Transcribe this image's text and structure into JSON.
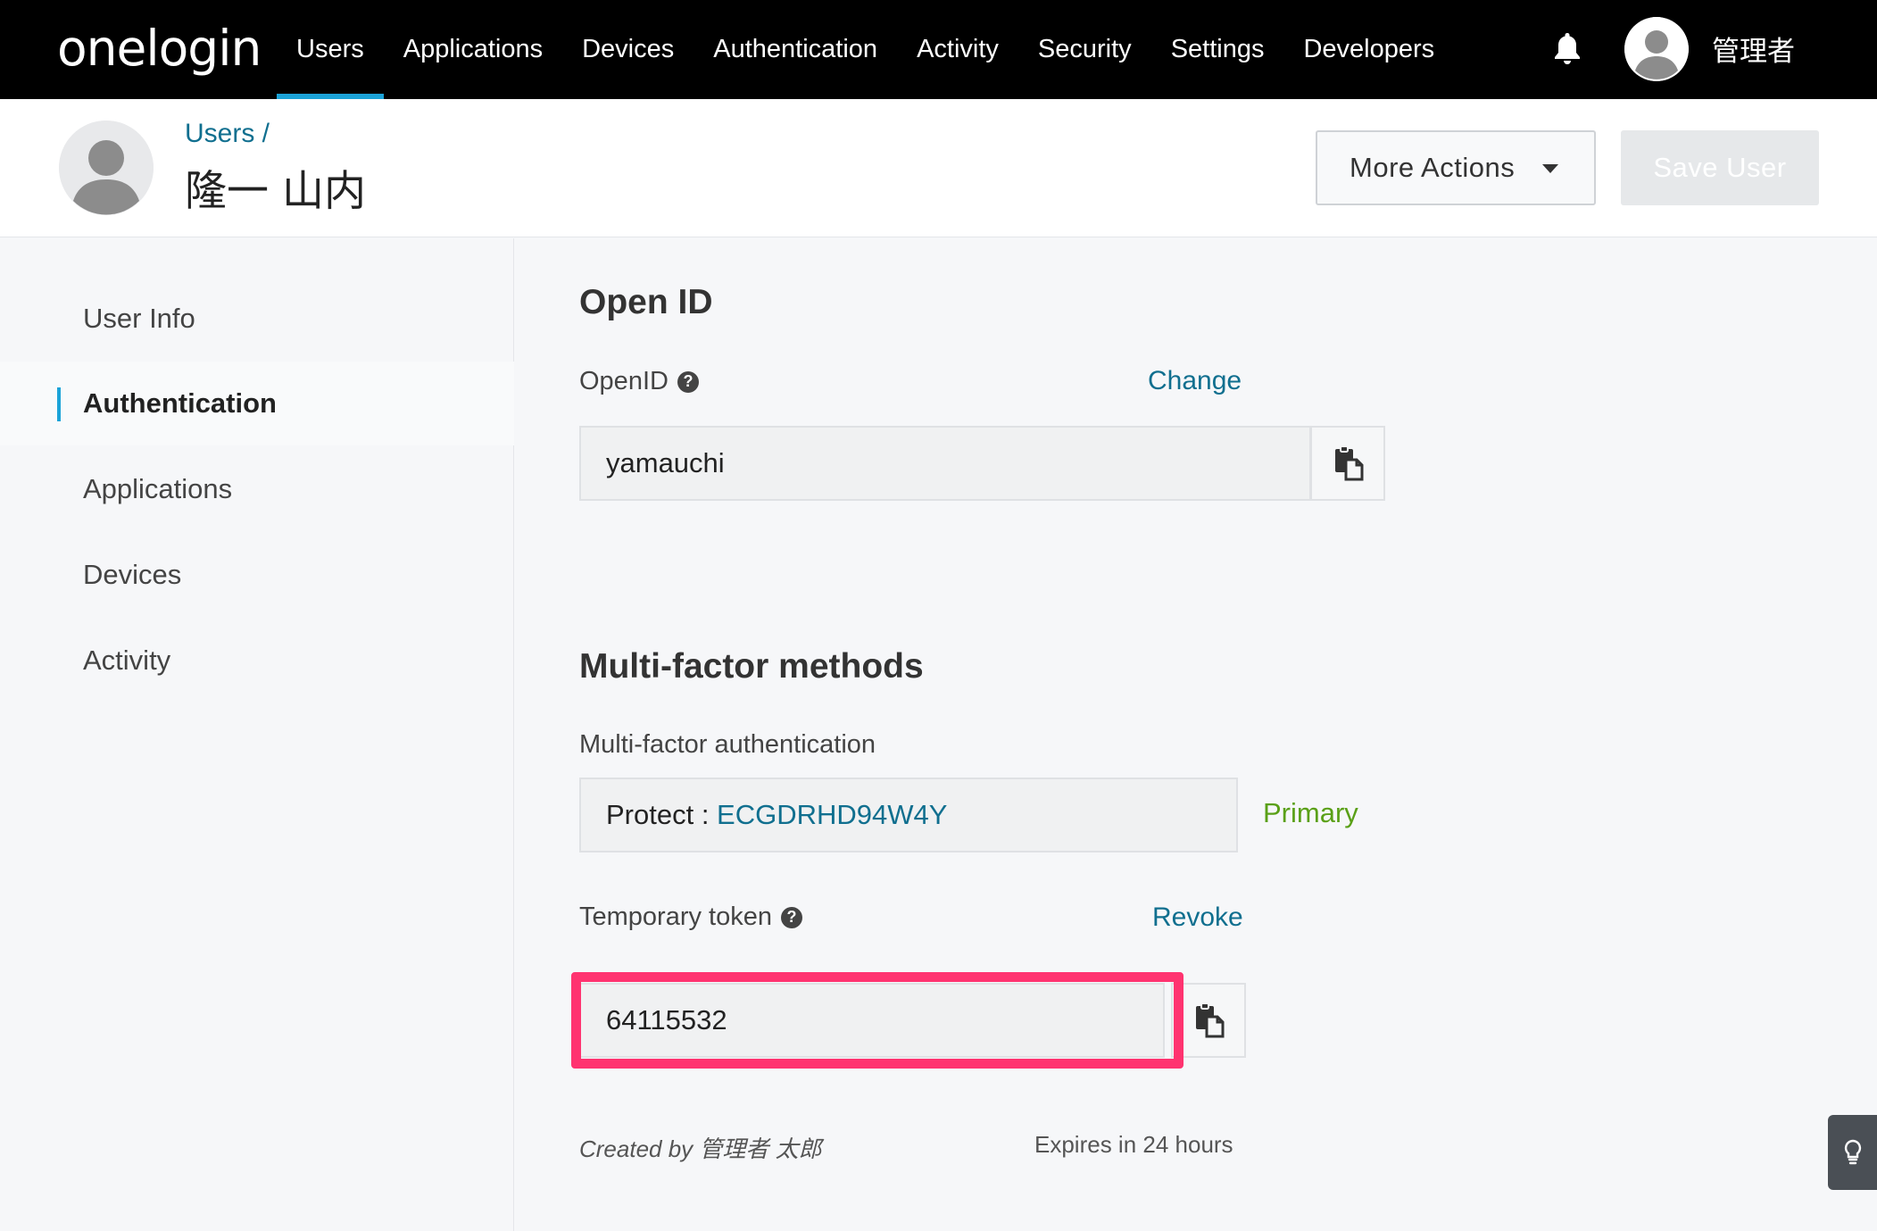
{
  "app": {
    "logo": "onelogin"
  },
  "topnav": {
    "items": [
      {
        "label": "Users",
        "active": true
      },
      {
        "label": "Applications"
      },
      {
        "label": "Devices"
      },
      {
        "label": "Authentication"
      },
      {
        "label": "Activity"
      },
      {
        "label": "Security"
      },
      {
        "label": "Settings"
      },
      {
        "label": "Developers"
      }
    ],
    "user_name": "管理者"
  },
  "header": {
    "breadcrumb": "Users /",
    "title": "隆一 山内",
    "more_actions_label": "More Actions",
    "save_label": "Save User"
  },
  "sidebar": {
    "items": [
      {
        "label": "User Info"
      },
      {
        "label": "Authentication",
        "active": true
      },
      {
        "label": "Applications"
      },
      {
        "label": "Devices"
      },
      {
        "label": "Activity"
      }
    ]
  },
  "openid": {
    "section_title": "Open ID",
    "field_label": "OpenID",
    "change_label": "Change",
    "value": "yamauchi"
  },
  "mfa": {
    "section_title": "Multi-factor methods",
    "field_label": "Multi-factor authentication",
    "method_prefix": "Protect : ",
    "method_value": "ECGDRHD94W4Y",
    "status": "Primary",
    "token_label": "Temporary token",
    "revoke_label": "Revoke",
    "token_value": "64115532",
    "created_by": "Created by 管理者 太郎",
    "expires": "Expires in 24 hours"
  },
  "colors": {
    "nav_bg": "#000000",
    "accent": "#1ba3d8",
    "link": "#106f8f",
    "primary_green": "#5aa017",
    "highlight": "#ff3370"
  },
  "icons": {
    "notifications": "bell-icon",
    "copy": "copy-icon",
    "help": "help-icon",
    "hint": "lightbulb-icon"
  }
}
